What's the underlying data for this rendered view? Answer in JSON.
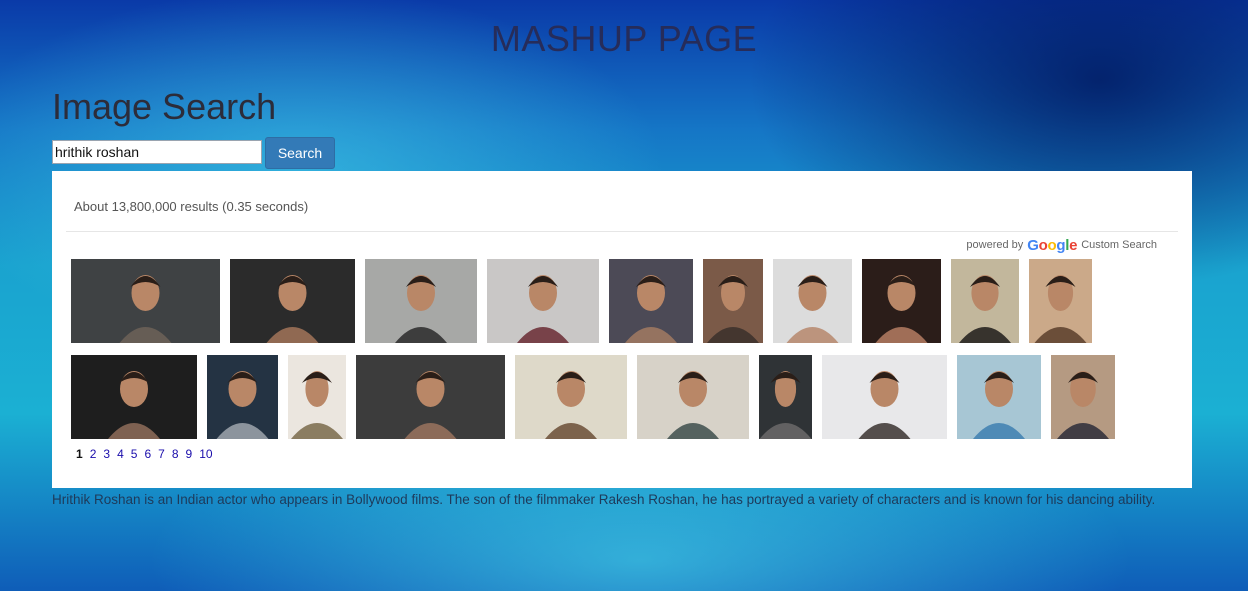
{
  "header": {
    "title": "MASHUP PAGE"
  },
  "search": {
    "heading": "Image Search",
    "query": "hrithik roshan",
    "button_label": "Search"
  },
  "results": {
    "stats": "About 13,800,000 results (0.35 seconds)",
    "powered_by": "powered by",
    "custom_search": "Custom Search",
    "images": [
      {
        "bg": "#3f4244",
        "fg": "#6d6258",
        "row": 1
      },
      {
        "bg": "#2b2b2b",
        "fg": "#a27459",
        "row": 1
      },
      {
        "bg": "#a7a8a6",
        "fg": "#2a2a2a",
        "row": 1
      },
      {
        "bg": "#c9c7c6",
        "fg": "#6a2a32",
        "row": 1
      },
      {
        "bg": "#4c4a56",
        "fg": "#a27a61",
        "row": 1
      },
      {
        "bg": "#7b5a48",
        "fg": "#3b302c",
        "row": 1
      },
      {
        "bg": "#dcdcdc",
        "fg": "#b6876c",
        "row": 1
      },
      {
        "bg": "#2b1d19",
        "fg": "#b57d63",
        "row": 1
      },
      {
        "bg": "#c2b79c",
        "fg": "#1f1c1a",
        "row": 1
      },
      {
        "bg": "#cba989",
        "fg": "#5a3e2b",
        "row": 1
      },
      {
        "bg": "#1e1e1e",
        "fg": "#8f6d5a",
        "row": 2
      },
      {
        "bg": "#243343",
        "fg": "#9fa6ad",
        "row": 2
      },
      {
        "bg": "#ebe6df",
        "fg": "#7a6a4b",
        "row": 2
      },
      {
        "bg": "#3c3c3c",
        "fg": "#9a735e",
        "row": 2
      },
      {
        "bg": "#ded9c9",
        "fg": "#6b4d36",
        "row": 2
      },
      {
        "bg": "#d7d2c8",
        "fg": "#3e4f4c",
        "row": 2
      },
      {
        "bg": "#2f3336",
        "fg": "#6b6a6a",
        "row": 2
      },
      {
        "bg": "#e8e8ea",
        "fg": "#3a3230",
        "row": 2
      },
      {
        "bg": "#a7c6d4",
        "fg": "#3e7fb0",
        "row": 2
      },
      {
        "bg": "#b59a82",
        "fg": "#2d2d3a",
        "row": 2
      }
    ],
    "pages": [
      "1",
      "2",
      "3",
      "4",
      "5",
      "6",
      "7",
      "8",
      "9",
      "10"
    ],
    "current_page": "1"
  },
  "description": "Hrithik Roshan is an Indian actor who appears in Bollywood films. The son of the filmmaker Rakesh Roshan, he has portrayed a variety of characters and is known for his dancing ability."
}
